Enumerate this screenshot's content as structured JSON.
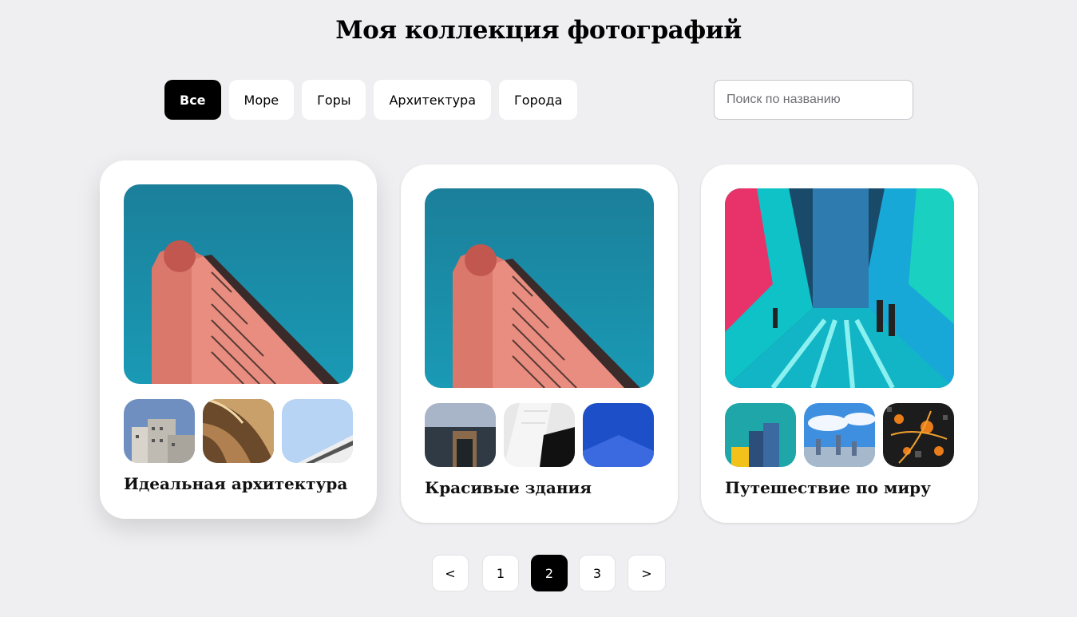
{
  "page": {
    "title": "Моя коллекция фотографий"
  },
  "filters": [
    "Все",
    "Море",
    "Горы",
    "Архитектура",
    "Города"
  ],
  "active_filter": "Все",
  "search": {
    "placeholder": "Поиск по названию",
    "value": ""
  },
  "cards": [
    {
      "title": "Идеальная архитектура"
    },
    {
      "title": "Красивые здания"
    },
    {
      "title": "Путешествие по миру"
    }
  ],
  "pagination": {
    "prev": "<",
    "pages": [
      "1",
      "2",
      "3"
    ],
    "current": "2",
    "next": ">"
  },
  "colors": {
    "accent": "#000000",
    "background": "#efeff1",
    "card": "#ffffff",
    "sky": "#1d8aa3",
    "building": "#e07f70"
  }
}
